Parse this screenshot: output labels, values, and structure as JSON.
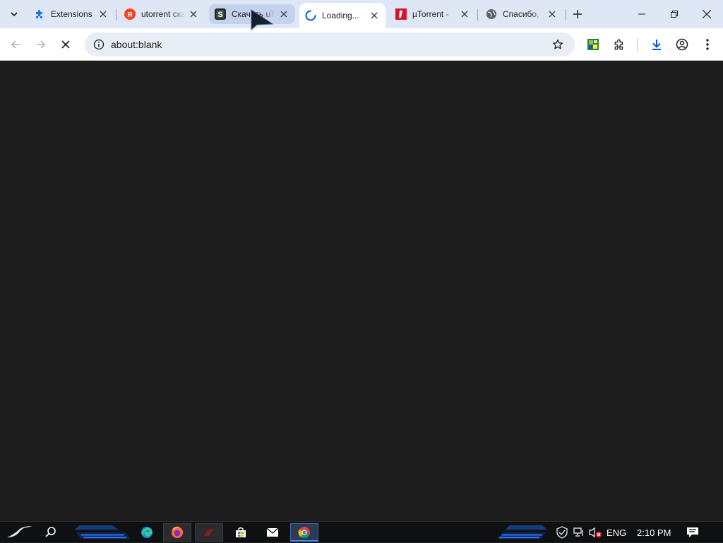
{
  "tabs": [
    {
      "title": "Extensions",
      "icon": "puzzle-icon",
      "state": "normal"
    },
    {
      "title": "utorrent скачать",
      "icon": "yandex-icon",
      "state": "normal"
    },
    {
      "title": "Скачать uTorrent",
      "icon": "site-s-icon",
      "state": "hover"
    },
    {
      "title": "Loading...",
      "icon": "loading-spinner-icon",
      "state": "active"
    },
    {
      "title": "µTorrent - ",
      "icon": "utorrent-red-icon",
      "state": "normal"
    },
    {
      "title": "Спасибо, ",
      "icon": "globe-icon",
      "state": "normal"
    }
  ],
  "toolbar": {
    "url": "about:blank",
    "back_icon": "back-arrow-icon",
    "forward_icon": "forward-arrow-icon",
    "stop_icon": "stop-loading-icon"
  },
  "taskbar": {
    "language": "ENG",
    "time": "2:10 PM"
  },
  "colors": {
    "tabstrip": "#dfe6f5",
    "content_bg": "#1c1c1d",
    "accent": "#0b57d0",
    "taskbar_accent": "#3f8cff"
  }
}
